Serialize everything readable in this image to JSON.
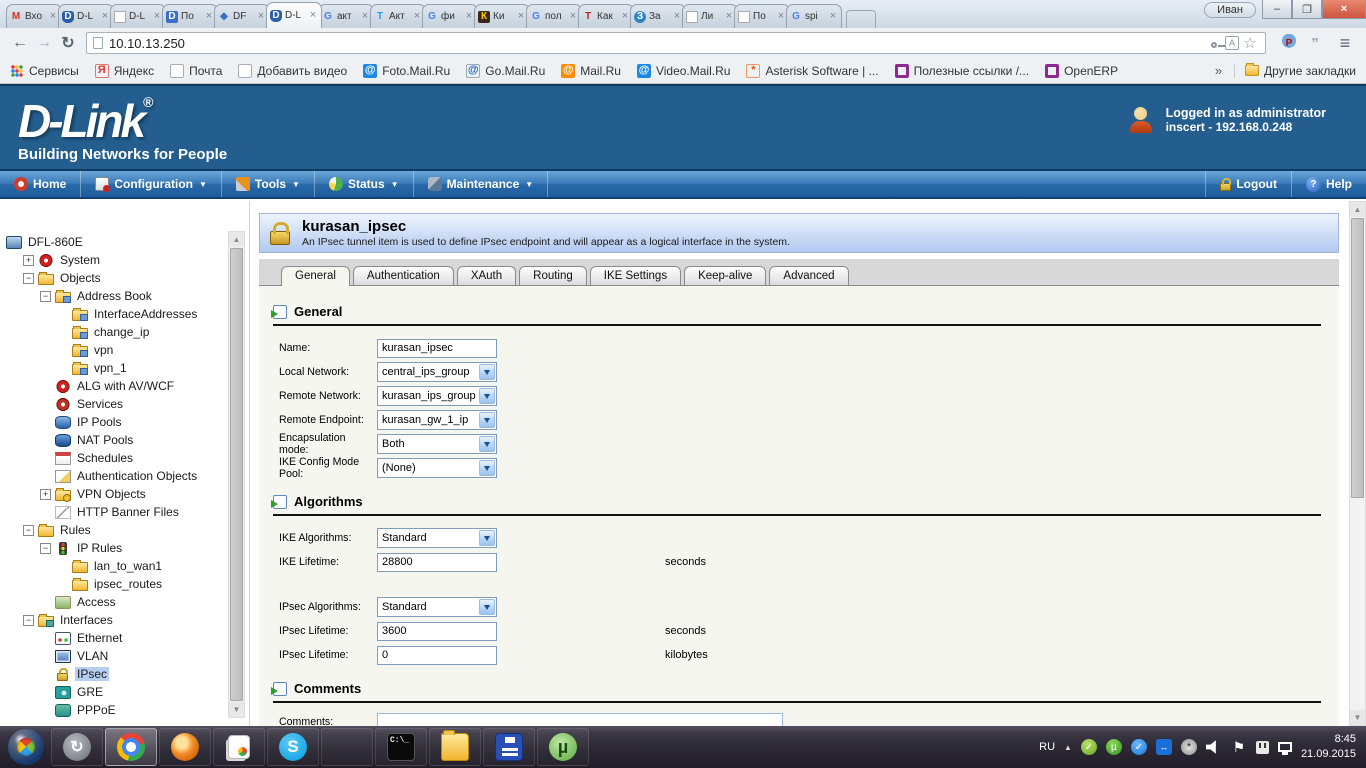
{
  "browser": {
    "profile": "Иван",
    "window_buttons": {
      "minimize": "–",
      "restore": "❐",
      "close": "×"
    },
    "tabs": [
      {
        "label": "Вхо",
        "icon": "gmail"
      },
      {
        "label": "D-L",
        "icon": "dlink-shield"
      },
      {
        "label": "D-L",
        "icon": "page"
      },
      {
        "label": "По",
        "icon": "d-blue"
      },
      {
        "label": "DF",
        "icon": "diamond"
      },
      {
        "label": "D-L",
        "icon": "dlink-shield",
        "active": true
      },
      {
        "label": "акт",
        "icon": "google"
      },
      {
        "label": "Акт",
        "icon": "t-blue"
      },
      {
        "label": "фи",
        "icon": "google"
      },
      {
        "label": "Ки",
        "icon": "kino"
      },
      {
        "label": "пол",
        "icon": "google"
      },
      {
        "label": "Как",
        "icon": "t-red"
      },
      {
        "label": "За",
        "icon": "blue-circle"
      },
      {
        "label": "Ли",
        "icon": "page"
      },
      {
        "label": "По",
        "icon": "page"
      },
      {
        "label": "spi",
        "icon": "google"
      }
    ],
    "toolbar": {
      "back": "←",
      "forward": "→",
      "reload": "↻",
      "url": "10.10.13.250",
      "star": "☆",
      "menu": "≡"
    },
    "bookmarks": [
      {
        "label": "Сервисы",
        "icon": "apps-grid"
      },
      {
        "label": "Яндекс",
        "icon": "yandex"
      },
      {
        "label": "Почта",
        "icon": "page"
      },
      {
        "label": "Добавить видео",
        "icon": "page"
      },
      {
        "label": "Foto.Mail.Ru",
        "icon": "at-blue"
      },
      {
        "label": "Go.Mail.Ru",
        "icon": "search-at"
      },
      {
        "label": "Mail.Ru",
        "icon": "at-orange"
      },
      {
        "label": "Video.Mail.Ru",
        "icon": "at-blue"
      },
      {
        "label": "Asterisk Software | ...",
        "icon": "asterisk"
      },
      {
        "label": "Полезные ссылки /...",
        "icon": "ring"
      },
      {
        "label": "OpenERP",
        "icon": "ring"
      }
    ],
    "bookmarks_overflow": "»",
    "other_bookmarks": "Другие закладки"
  },
  "site": {
    "logo": "D-Link",
    "logo_reg": "®",
    "tagline": "Building Networks for People",
    "login_line1": "Logged in as administrator",
    "login_line2": "inscert - 192.168.0.248",
    "nav": [
      {
        "label": "Home",
        "icon": "home",
        "dropdown": false
      },
      {
        "label": "Configuration",
        "icon": "configuration",
        "dropdown": true
      },
      {
        "label": "Tools",
        "icon": "tools",
        "dropdown": true
      },
      {
        "label": "Status",
        "icon": "status",
        "dropdown": true
      },
      {
        "label": "Maintenance",
        "icon": "maintenance",
        "dropdown": true
      }
    ],
    "nav_right": [
      {
        "label": "Logout",
        "icon": "padlock"
      },
      {
        "label": "Help",
        "icon": "help"
      }
    ],
    "dropdown_glyph": "▼"
  },
  "sidebar": {
    "tree": [
      {
        "label": "DFL-860E",
        "depth": 0,
        "icon": "monitor"
      },
      {
        "label": "System",
        "depth": 1,
        "exp": "+",
        "icon": "gear"
      },
      {
        "label": "Objects",
        "depth": 1,
        "exp": "−",
        "icon": "folder"
      },
      {
        "label": "Address Book",
        "depth": 2,
        "exp": "−",
        "icon": "folder-card"
      },
      {
        "label": "InterfaceAddresses",
        "depth": 3,
        "icon": "folder-card"
      },
      {
        "label": "change_ip",
        "depth": 3,
        "icon": "folder-card"
      },
      {
        "label": "vpn",
        "depth": 3,
        "icon": "folder-card"
      },
      {
        "label": "vpn_1",
        "depth": 3,
        "icon": "folder-card"
      },
      {
        "label": "ALG with AV/WCF",
        "depth": 2,
        "icon": "gear"
      },
      {
        "label": "Services",
        "depth": 2,
        "icon": "gear2"
      },
      {
        "label": "IP Pools",
        "depth": 2,
        "icon": "db"
      },
      {
        "label": "NAT Pools",
        "depth": 2,
        "icon": "db2"
      },
      {
        "label": "Schedules",
        "depth": 2,
        "icon": "schedule"
      },
      {
        "label": "Authentication Objects",
        "depth": 2,
        "icon": "auth"
      },
      {
        "label": "VPN Objects",
        "depth": 2,
        "exp": "+",
        "icon": "vpnfolder"
      },
      {
        "label": "HTTP Banner Files",
        "depth": 2,
        "icon": "banner"
      },
      {
        "label": "Rules",
        "depth": 1,
        "exp": "−",
        "icon": "rules"
      },
      {
        "label": "IP Rules",
        "depth": 2,
        "exp": "−",
        "icon": "traffic"
      },
      {
        "label": "lan_to_wan1",
        "depth": 3,
        "icon": "rulefolder"
      },
      {
        "label": "ipsec_routes",
        "depth": 3,
        "icon": "rulefolder"
      },
      {
        "label": "Access",
        "depth": 2,
        "icon": "access"
      },
      {
        "label": "Interfaces",
        "depth": 1,
        "exp": "−",
        "icon": "iffolder"
      },
      {
        "label": "Ethernet",
        "depth": 2,
        "icon": "ethernet"
      },
      {
        "label": "VLAN",
        "depth": 2,
        "icon": "vlan"
      },
      {
        "label": "IPsec",
        "depth": 2,
        "icon": "ipsec",
        "selected": true
      },
      {
        "label": "GRE",
        "depth": 2,
        "icon": "gre"
      },
      {
        "label": "PPPoE",
        "depth": 2,
        "icon": "pppoe"
      }
    ]
  },
  "main": {
    "title": "kurasan_ipsec",
    "subtitle": "An IPsec tunnel item is used to define IPsec endpoint and will appear as a logical interface in the system.",
    "tabs": [
      "General",
      "Authentication",
      "XAuth",
      "Routing",
      "IKE Settings",
      "Keep-alive",
      "Advanced"
    ],
    "active_tab": "General",
    "sections": [
      {
        "title": "General",
        "rows": [
          {
            "key": "name",
            "label": "Name:",
            "control": "input",
            "value": "kurasan_ipsec"
          },
          {
            "key": "local-network",
            "label": "Local Network:",
            "control": "select",
            "value": "central_ips_group"
          },
          {
            "key": "remote-network",
            "label": "Remote Network:",
            "control": "select",
            "value": "kurasan_ips_group"
          },
          {
            "key": "remote-endpoint",
            "label": "Remote Endpoint:",
            "control": "select",
            "value": "kurasan_gw_1_ip"
          },
          {
            "key": "encapsulation-mode",
            "label": "Encapsulation mode:",
            "control": "select",
            "value": "Both"
          },
          {
            "key": "ike-config-mode-pool",
            "label": "IKE Config Mode Pool:",
            "control": "select",
            "value": "(None)"
          }
        ]
      },
      {
        "title": "Algorithms",
        "rows": [
          {
            "key": "ike-algorithms",
            "label": "IKE Algorithms:",
            "control": "select",
            "value": "Standard"
          },
          {
            "key": "ike-lifetime",
            "label": "IKE Lifetime:",
            "control": "input",
            "value": "28800",
            "unit": "seconds"
          },
          {
            "gap": true
          },
          {
            "key": "ipsec-algorithms",
            "label": "IPsec Algorithms:",
            "control": "select",
            "value": "Standard"
          },
          {
            "key": "ipsec-lifetime-seconds",
            "label": "IPsec Lifetime:",
            "control": "input",
            "value": "3600",
            "unit": "seconds"
          },
          {
            "key": "ipsec-lifetime-kilobytes",
            "label": "IPsec Lifetime:",
            "control": "input",
            "value": "0",
            "unit": "kilobytes"
          }
        ]
      },
      {
        "title": "Comments",
        "rows": [
          {
            "key": "comments",
            "label": "Comments:",
            "control": "textarea",
            "value": ""
          }
        ]
      }
    ]
  },
  "taskbar": {
    "apps": [
      "backup",
      "chrome",
      "firefox",
      "pages",
      "skype",
      "control-panel",
      "cmd",
      "explorer",
      "floppy",
      "utorrent"
    ],
    "active_app": "chrome",
    "tray": {
      "lang": "RU",
      "expand_arrow": "▲",
      "icons": [
        "green-check",
        "utorrent",
        "blue-check",
        "teamviewer",
        "plugin",
        "volume",
        "flag",
        "power",
        "network"
      ],
      "time": "8:45",
      "date": "21.09.2015"
    }
  }
}
